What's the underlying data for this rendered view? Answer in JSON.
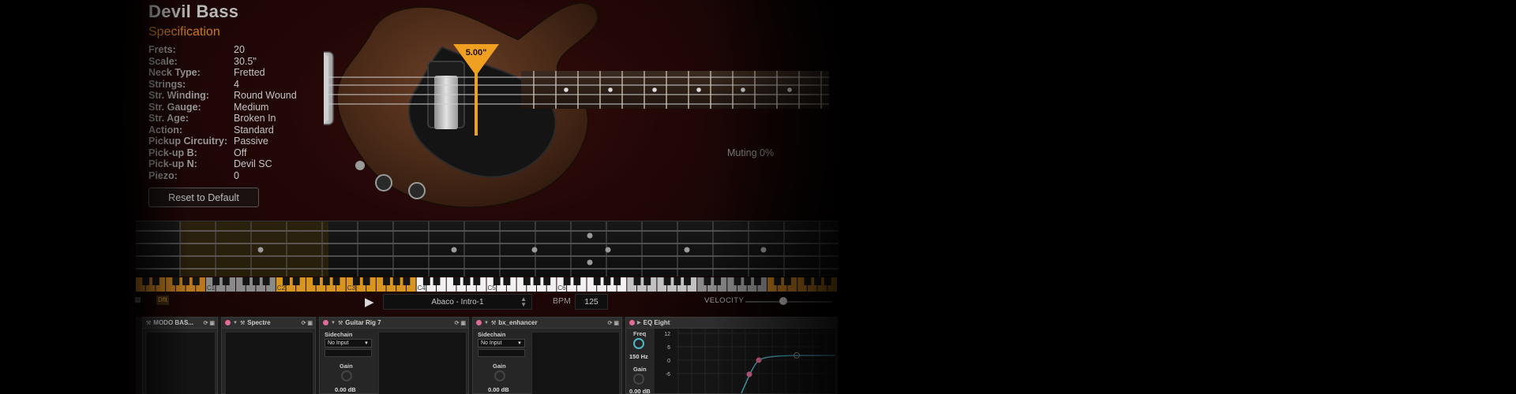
{
  "instrument": {
    "name": "Devil Bass",
    "section_title": "Specification",
    "specs": [
      {
        "key": "Frets:",
        "value": "20"
      },
      {
        "key": "Scale:",
        "value": "30.5\""
      },
      {
        "key": "Neck Type:",
        "value": "Fretted"
      },
      {
        "key": "Strings:",
        "value": "4"
      },
      {
        "key": "Str. Winding:",
        "value": "Round Wound"
      },
      {
        "key": "Str. Gauge:",
        "value": "Medium"
      },
      {
        "key": "Str. Age:",
        "value": "Broken In"
      },
      {
        "key": "Action:",
        "value": "Standard"
      },
      {
        "key": "Pickup Circuitry:",
        "value": "Passive"
      },
      {
        "key": "Pick-up B:",
        "value": "Off"
      },
      {
        "key": "Pick-up N:",
        "value": "Devil SC"
      },
      {
        "key": "Piezo:",
        "value": "0"
      }
    ],
    "reset_label": "Reset to Default",
    "pluck_marker": "5.00\"",
    "muting_label": "Muting 0%"
  },
  "keyboard": {
    "octave_labels": [
      "C1",
      "C2",
      "C3",
      "C4",
      "C5",
      "C6"
    ]
  },
  "transport": {
    "preset": "Abaco - Intro-1",
    "bpm_label": "BPM",
    "bpm_value": "125",
    "velocity_label": "VELOCITY",
    "velocity_level": 0.44,
    "slot_b_label": "Dflt"
  },
  "rack": {
    "devices": [
      {
        "name": "MODO BAS..."
      },
      {
        "name": "Spectre"
      },
      {
        "name": "Guitar Rig 7",
        "sidechain_label": "Sidechain",
        "sidechain_value": "No Input",
        "gain_label": "Gain",
        "gain_value": "0.00 dB"
      },
      {
        "name": "bx_enhancer",
        "sidechain_label": "Sidechain",
        "sidechain_value": "No Input",
        "gain_label": "Gain",
        "gain_value": "0.00 dB"
      },
      {
        "name": "EQ Eight",
        "freq_label": "Freq",
        "freq_value": "150 Hz",
        "gain_label": "Gain",
        "gain_value": "0.00 dB",
        "db_ticks": [
          "12",
          "6",
          "0",
          "-6"
        ]
      }
    ]
  },
  "colors": {
    "accent_orange": "#f0a020",
    "body_wood": "#4a2a18",
    "device_power": "#e06a9a",
    "knob_teal": "#4fb7c9"
  }
}
